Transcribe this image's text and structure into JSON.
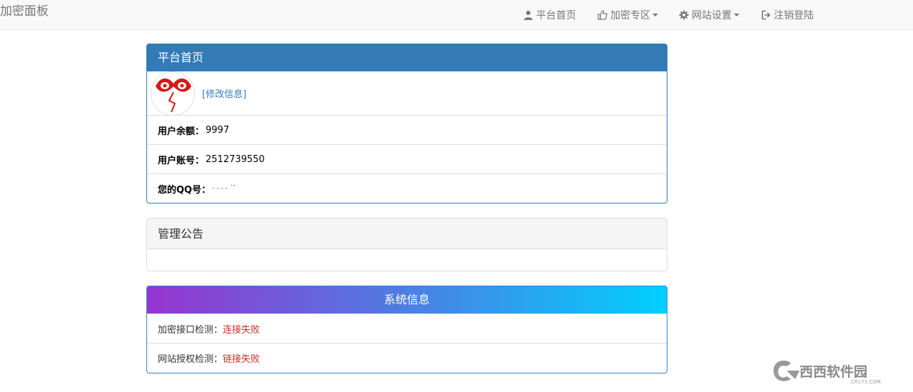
{
  "navbar": {
    "brand": "加密面板",
    "items": [
      {
        "label": "平台首页",
        "icon": "user-icon"
      },
      {
        "label": "加密专区",
        "icon": "thumbs-up-icon"
      },
      {
        "label": "网站设置",
        "icon": "gear-icon"
      },
      {
        "label": "注销登陆",
        "icon": "logout-icon"
      }
    ]
  },
  "home_panel": {
    "title": "平台首页",
    "edit_link": "[修改信息]",
    "balance_label": "用户余额：",
    "balance_value": "9997",
    "account_label": "用户账号：",
    "account_value": "2512739550",
    "qq_label": "您的QQ号：",
    "qq_value": "- - - -  ˊˆ"
  },
  "notice_panel": {
    "title": "管理公告"
  },
  "system_panel": {
    "title": "系统信息",
    "api_label": "加密接口检测：",
    "api_status": "连接失败",
    "auth_label": "网站授权检测：",
    "auth_status": "链接失败"
  },
  "watermark": {
    "text": "西西软件园",
    "sub": "CR173.COM"
  },
  "colors": {
    "primary": "#337ab7",
    "error": "#c9302c",
    "gradient_start": "#9634cf",
    "gradient_end": "#00d0ff"
  }
}
